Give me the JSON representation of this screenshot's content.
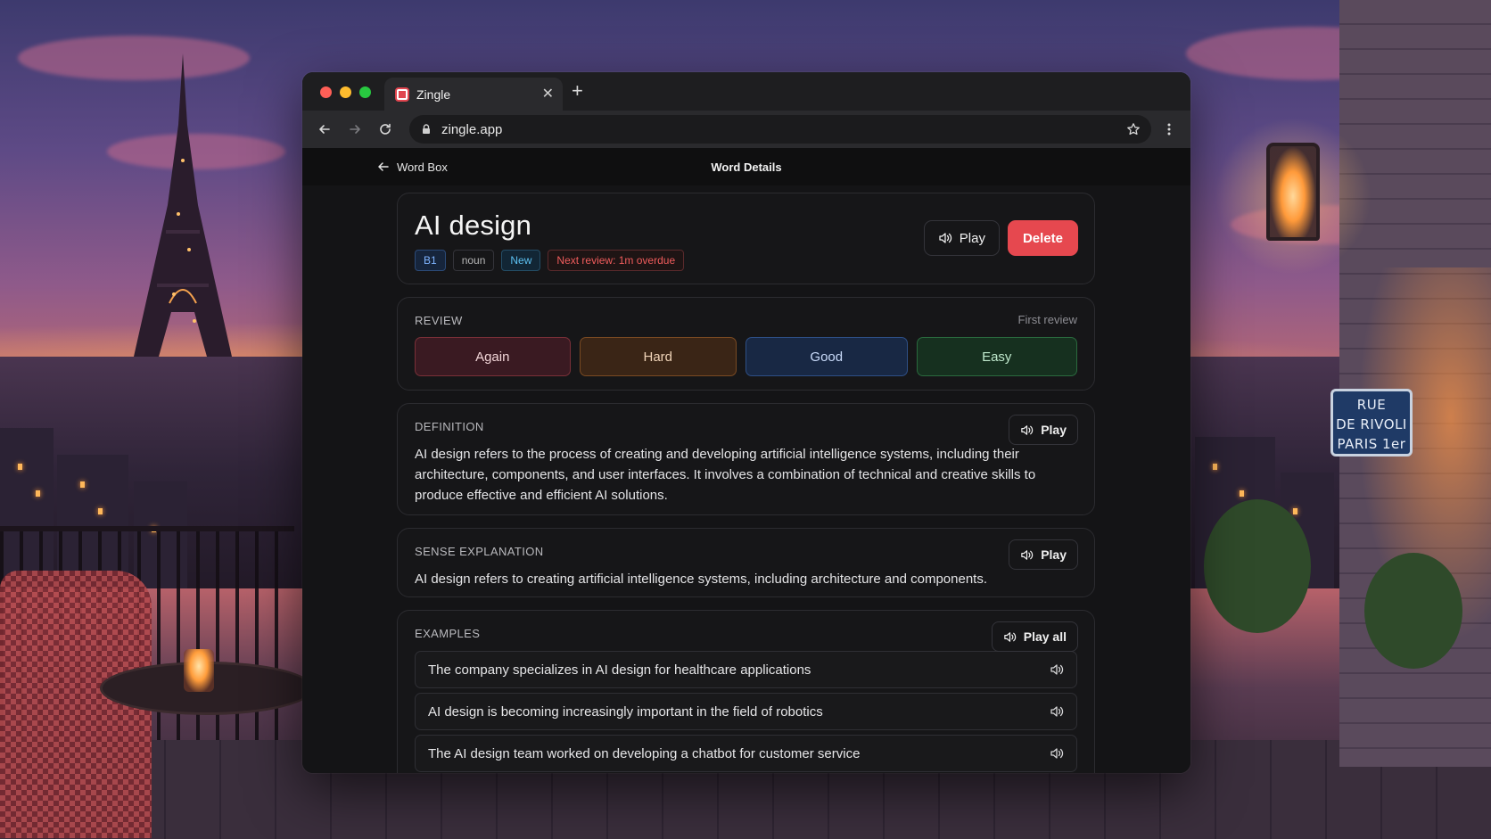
{
  "browser": {
    "tab_title": "Zingle",
    "url": "zingle.app"
  },
  "scene": {
    "street_sign_line1": "RUE",
    "street_sign_line2": "DE RIVOLI",
    "street_sign_line3": "PARIS 1er"
  },
  "header": {
    "back_label": "Word Box",
    "title": "Word Details"
  },
  "word": {
    "term": "AI design",
    "level": "B1",
    "pos": "noun",
    "status": "New",
    "next_review": "Next review: 1m overdue",
    "play_label": "Play",
    "delete_label": "Delete"
  },
  "review": {
    "label": "REVIEW",
    "note": "First review",
    "buttons": [
      "Again",
      "Hard",
      "Good",
      "Easy"
    ]
  },
  "definition": {
    "label": "DEFINITION",
    "play_label": "Play",
    "text": "AI design refers to the process of creating and developing artificial intelligence systems, including their architecture, components, and user interfaces. It involves a combination of technical and creative skills to produce effective and efficient AI solutions."
  },
  "sense": {
    "label": "SENSE EXPLANATION",
    "play_label": "Play",
    "text": "AI design refers to creating artificial intelligence systems, including architecture and components."
  },
  "examples": {
    "label": "EXAMPLES",
    "play_all_label": "Play all",
    "items": [
      "The company specializes in AI design for healthcare applications",
      "AI design is becoming increasingly important in the field of robotics",
      "The AI design team worked on developing a chatbot for customer service"
    ]
  },
  "colors": {
    "accent_delete": "#e6484f",
    "again": "#7a3038",
    "hard": "#7a4a22",
    "good": "#2e4f86",
    "easy": "#2a6a3e"
  }
}
